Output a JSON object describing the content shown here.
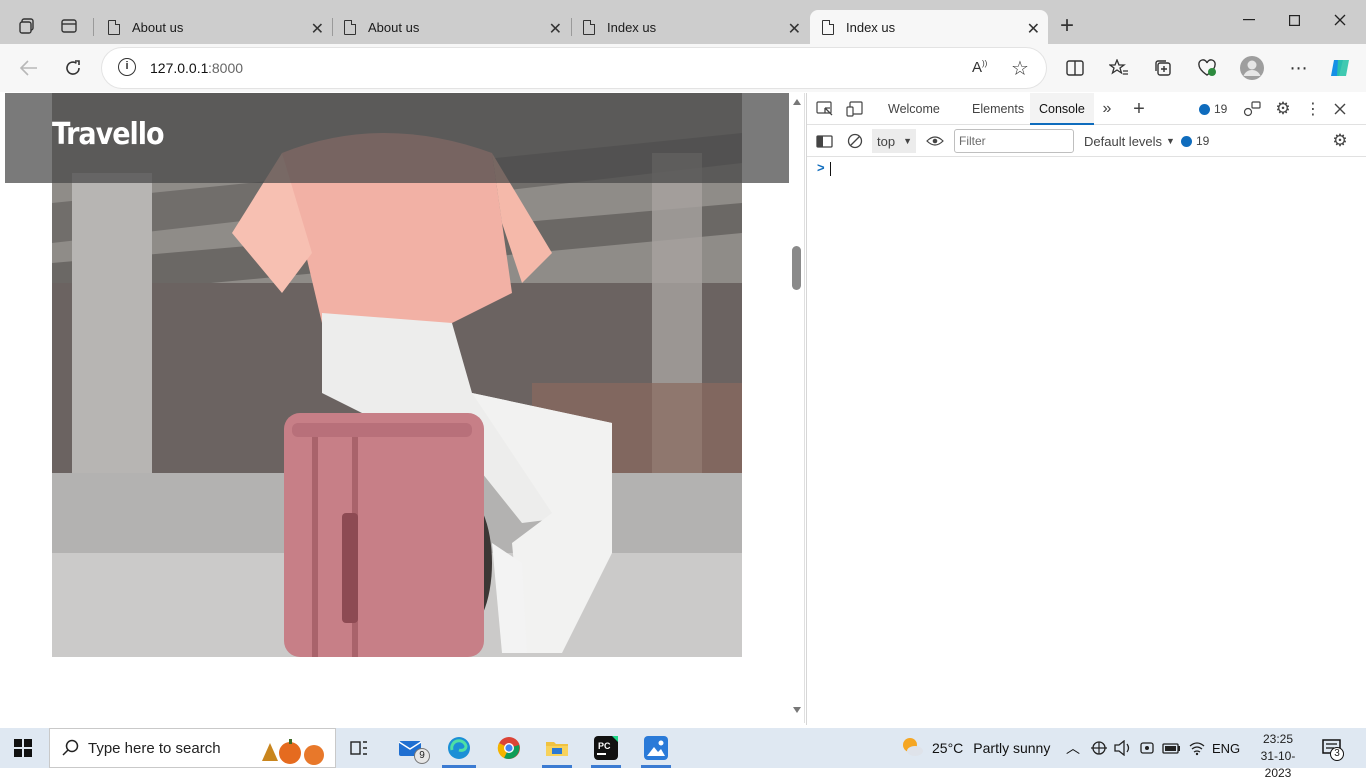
{
  "browser": {
    "tabs": [
      {
        "title": "About us"
      },
      {
        "title": "About us"
      },
      {
        "title": "Index us"
      },
      {
        "title": "Index us",
        "active": true
      }
    ],
    "new_tab_label": "+",
    "address": {
      "host": "127.0.0.1",
      "port": ":8000"
    }
  },
  "page": {
    "brand": "Travello"
  },
  "devtools": {
    "tabs": [
      "Welcome",
      "Elements",
      "Console"
    ],
    "active_tab": "Console",
    "issues_count": "19",
    "context": "top",
    "filter_placeholder": "Filter",
    "levels_label": "Default levels",
    "messages_count": "19",
    "prompt": ">"
  },
  "taskbar": {
    "search_placeholder": "Type here to search",
    "mail_badge": "9",
    "weather": {
      "temp": "25°C",
      "condition": "Partly sunny"
    },
    "language": "ENG",
    "time": "23:25",
    "date": "31-10-2023",
    "notifications": "3"
  },
  "colors": {
    "accent": "#0f6cbd",
    "taskbar": "#dfe8f2",
    "tabstrip": "#cdcdcd"
  }
}
